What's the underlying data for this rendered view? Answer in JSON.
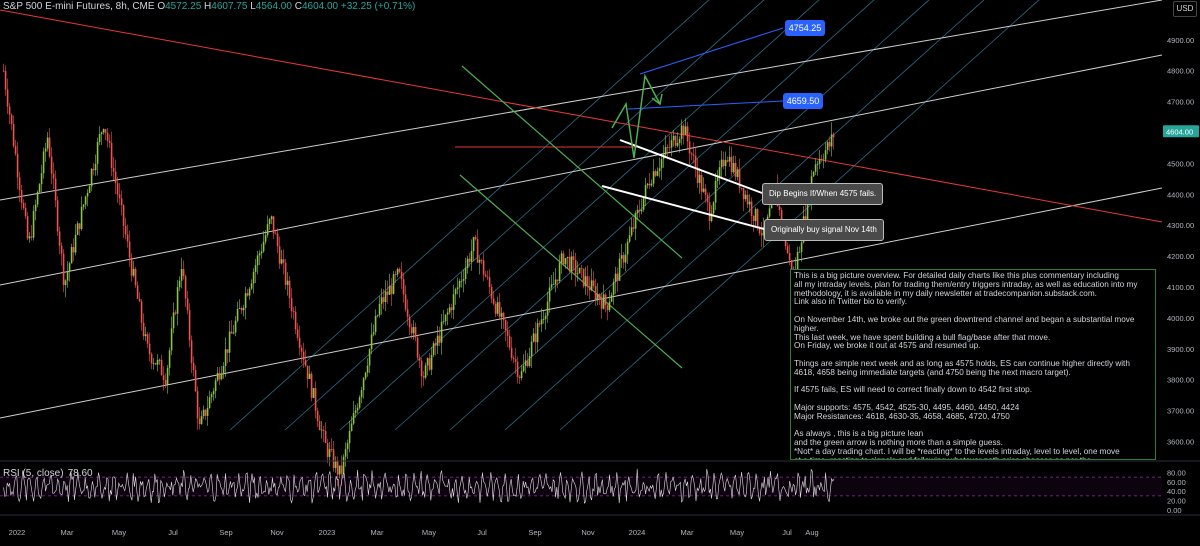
{
  "header": {
    "symbol": "S&P 500 E-mini Futures, 8h, CME",
    "open_label": "O",
    "open": "4572.25",
    "high_label": "H",
    "high": "4607.75",
    "low_label": "L",
    "low": "4564.00",
    "close_label": "C",
    "close": "4604.00",
    "change": "+32.25 (+0.71%)"
  },
  "currency_button": "USD",
  "rsi": {
    "label": "RSI (5, close)",
    "value": "78.60"
  },
  "annotations": {
    "target_high": "4754.25",
    "target_mid": "4659.50",
    "dip_callout": "Dip Begins If/When 4575 fails.",
    "buy_callout": "Originally buy signal Nov 14th",
    "commentary": "This is a big picture overview. For detailed daily charts like this plus commentary including\nall my intraday levels, plan for trading them/entry triggers intraday, as well as education into my\nmethodology, it is available in my daily newsletter at tradecompanion.substack.com.\nLink also in Twitter bio to verify.\n\nOn November 14th, we broke out the green downtrend channel and began a substantial move higher.\nThis last week, we have spent building a bull flag/base after that move.\nOn Friday, we broke it out at 4575 and resumed up.\n\nThings are simple next week and as long as 4575 holds, ES can continue higher directly with\n4618, 4658 being immediate targets (and 4750 being the next macro target).\n\nIf 4575 fails, ES will need to correct finally down to 4542 first stop.\n\nMajor supports: 4575, 4542, 4525-30, 4495, 4460, 4450, 4424\nMajor Resistances: 4618, 4630-35, 4658, 4685, 4720, 4750\n\nAs always , this is a big picture lean\nand the green arrow is nothing more than a simple guess.\n*Not* a day trading chart. I will be *reacting* to the levels intraday, level to level, one move\nat a time, reacting to signals and following whatever path price chooses as per the\nnewsletter plan. No crystals balls needed as a trader"
  },
  "colors": {
    "background": "#000000",
    "up_candle": "#26a69a",
    "down_candle": "#ef5350",
    "price_candle_up": "#8bc34a",
    "channel_green": "#4caf50",
    "red_trendline": "#e53935",
    "white_trendline": "#cfcfcf",
    "fib_blue": "#4fc3f7",
    "target_blue": "#2962ff",
    "rsi_line": "#e0e0e0",
    "rsi_band": "#9c27b0"
  },
  "chart_data": [
    {
      "type": "line",
      "subtype": "candlestick",
      "title": "S&P 500 E-mini Futures, 8h, CME",
      "x_tick_labels": [
        "2022",
        "Mar",
        "May",
        "Jul",
        "Sep",
        "Nov",
        "2023",
        "Mar",
        "May",
        "Jul",
        "Sep",
        "Nov",
        "2024",
        "Mar",
        "May",
        "Jul",
        "Aug"
      ],
      "xlim": [
        "2022-01-01",
        "2024-08-31"
      ],
      "y_tick_labels": [
        "3600.00",
        "3700.00",
        "3800.00",
        "3900.00",
        "4000.00",
        "4100.00",
        "4200.00",
        "4300.00",
        "4400.00",
        "4500.00",
        "4600.00",
        "4700.00",
        "4800.00",
        "4900.00"
      ],
      "ylim": [
        3540,
        4990
      ],
      "y_axis_position": "right",
      "last_price": "4604.00",
      "series": [
        {
          "x": [
            "2022-01-04",
            "2022-01-25",
            "2022-02-10",
            "2022-02-24",
            "2022-03-29",
            "2022-05-04",
            "2022-05-20",
            "2022-06-02",
            "2022-06-17",
            "2022-08-16",
            "2022-09-30",
            "2022-10-13",
            "2022-11-15",
            "2022-12-01",
            "2022-12-22",
            "2023-02-02",
            "2023-03-13",
            "2023-04-18",
            "2023-05-24",
            "2023-06-30",
            "2023-07-27",
            "2023-08-18",
            "2023-09-01",
            "2023-10-03",
            "2023-10-12",
            "2023-10-27",
            "2023-11-14",
            "2023-11-27",
            "2023-12-01"
          ],
          "values": [
            4800,
            4230,
            4590,
            4110,
            4640,
            3900,
            3810,
            4180,
            3640,
            4320,
            3590,
            3490,
            4040,
            4140,
            3810,
            4240,
            3810,
            4200,
            4040,
            4460,
            4620,
            4340,
            4540,
            4260,
            4420,
            4120,
            4500,
            4560,
            4604
          ]
        }
      ],
      "drawings": {
        "price_targets": [
          4754.25,
          4659.5
        ],
        "callouts": [
          "Dip Begins If/When 4575 fails.",
          "Originally buy signal Nov 14th"
        ],
        "projection": "green zigzag arrow up toward 4754.25"
      }
    },
    {
      "type": "line",
      "title": "RSI (5, close)",
      "y_tick_labels": [
        "0.00",
        "20.00",
        "40.00",
        "60.00",
        "80.00"
      ],
      "ylim": [
        0,
        100
      ],
      "bands": [
        30,
        70
      ],
      "last_value": 78.6
    }
  ]
}
